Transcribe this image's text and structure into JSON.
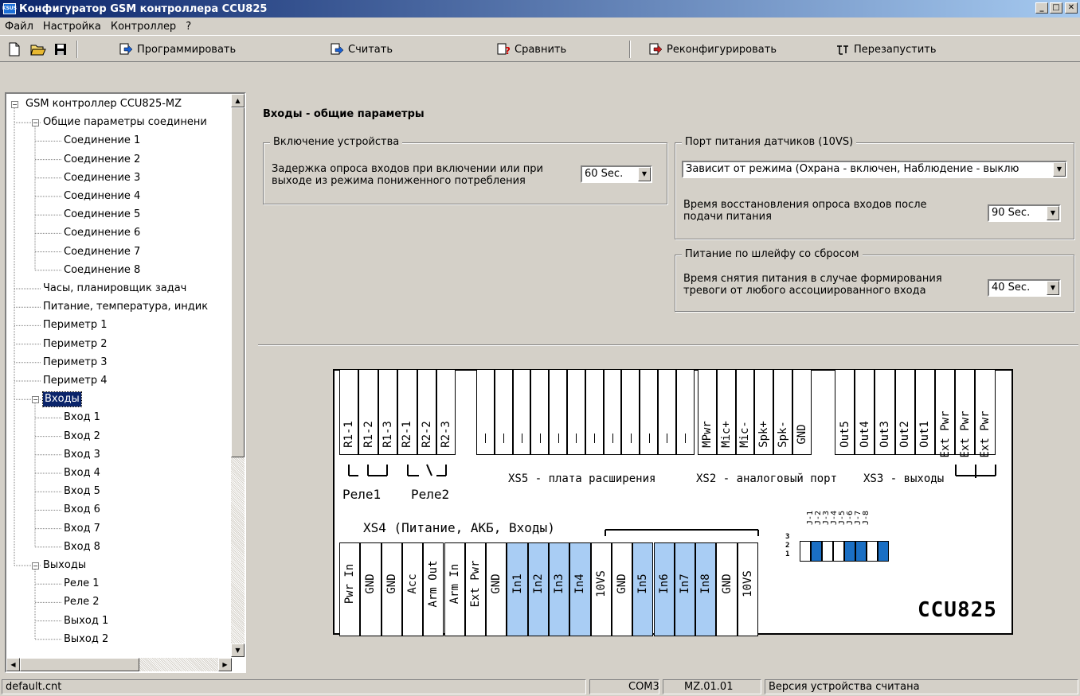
{
  "window": {
    "title": "Конфигуратор GSM контроллера CCU825",
    "app_icon": "ksus-icon",
    "title_color": "#0a246a"
  },
  "menu": {
    "items": [
      "Файл",
      "Настройка",
      "Контроллер",
      "?"
    ]
  },
  "toolbar": {
    "program": "Программировать",
    "read": "Считать",
    "compare": "Сравнить",
    "reconfigure": "Реконфигурировать",
    "restart": "Перезапустить"
  },
  "tree": {
    "items": [
      {
        "label": "GSM контроллер CCU825-MZ",
        "level": 0,
        "expandable": true
      },
      {
        "label": "Общие параметры соединени",
        "level": 1,
        "expandable": true
      },
      {
        "label": "Соединение 1",
        "level": 2
      },
      {
        "label": "Соединение 2",
        "level": 2
      },
      {
        "label": "Соединение 3",
        "level": 2
      },
      {
        "label": "Соединение 4",
        "level": 2
      },
      {
        "label": "Соединение 5",
        "level": 2
      },
      {
        "label": "Соединение 6",
        "level": 2
      },
      {
        "label": "Соединение 7",
        "level": 2
      },
      {
        "label": "Соединение 8",
        "level": 2
      },
      {
        "label": "Часы, планировщик задач",
        "level": 1
      },
      {
        "label": "Питание, температура, индик",
        "level": 1
      },
      {
        "label": "Периметр 1",
        "level": 1
      },
      {
        "label": "Периметр 2",
        "level": 1
      },
      {
        "label": "Периметр 3",
        "level": 1
      },
      {
        "label": "Периметр 4",
        "level": 1
      },
      {
        "label": "Входы",
        "level": 1,
        "expandable": true,
        "selected": true
      },
      {
        "label": "Вход 1",
        "level": 2
      },
      {
        "label": "Вход 2",
        "level": 2
      },
      {
        "label": "Вход 3",
        "level": 2
      },
      {
        "label": "Вход 4",
        "level": 2
      },
      {
        "label": "Вход 5",
        "level": 2
      },
      {
        "label": "Вход 6",
        "level": 2
      },
      {
        "label": "Вход 7",
        "level": 2
      },
      {
        "label": "Вход 8",
        "level": 2
      },
      {
        "label": "Выходы",
        "level": 1,
        "expandable": true
      },
      {
        "label": "Реле 1",
        "level": 2
      },
      {
        "label": "Реле 2",
        "level": 2
      },
      {
        "label": "Выход 1",
        "level": 2
      },
      {
        "label": "Выход 2",
        "level": 2
      }
    ]
  },
  "panel": {
    "title": "Входы - общие параметры",
    "group1": {
      "title": "Включение устройства",
      "label_line1": "Задержка опроса входов при включении или при",
      "label_line2": "выходе из режима пониженного потребления",
      "value": "60 Sec."
    },
    "group2": {
      "title": "Порт питания датчиков (10VS)",
      "mode_value": "Зависит от режима (Охрана - включен, Наблюдение - выклю",
      "label_line1": "Время восстановления опроса входов после",
      "label_line2": "подачи питания",
      "value": "90 Sec."
    },
    "group3": {
      "title": "Питание по шлейфу со сбросом",
      "label_line1": "Время снятия питания в случае формирования",
      "label_line2": "тревоги от любого ассоциированного входа",
      "value": "40 Sec."
    }
  },
  "board": {
    "highlight_color": "#a9cdf4",
    "jumper_color": "#1a6fc4",
    "top_pins_relay": [
      "R1-1",
      "R1-2",
      "R1-3",
      "R2-1",
      "R2-2",
      "R2-3"
    ],
    "top_pins_analog": [
      "MPwr",
      "Mic+",
      "Mic-",
      "Spk+",
      "Spk-",
      "GND"
    ],
    "top_pins_outputs": [
      "Out5",
      "Out4",
      "Out3",
      "Out2",
      "Out1",
      "Ext Pwr",
      "Ext Pwr",
      "Ext Pwr"
    ],
    "relay1_label": "Реле1",
    "relay2_label": "Реле2",
    "xs5_label": "XS5 - плата расширения",
    "xs2_label": "XS2 - аналоговый порт",
    "xs3_label": "XS3 - выходы",
    "xs4_label": "XS4 (Питание, АКБ, Входы)",
    "bottom_pins": [
      "Pwr In",
      "GND",
      "GND",
      "Acc",
      "Arm Out",
      "Arm In",
      "Ext Pwr",
      "GND",
      "In1",
      "In2",
      "In3",
      "In4",
      "10VS",
      "GND",
      "In5",
      "In6",
      "In7",
      "In8",
      "GND",
      "10VS"
    ],
    "bottom_highlight": [
      8,
      9,
      10,
      11,
      14,
      15,
      16,
      17
    ],
    "jumper_labels": [
      "J-1",
      "J-2",
      "J-3",
      "J-4",
      "J-5",
      "J-6",
      "J-7",
      "J-8"
    ],
    "jumper_rows": [
      "3",
      "2",
      "1"
    ],
    "model": "CCU825"
  },
  "status": {
    "file": "default.cnt",
    "port": "COM3",
    "version": "MZ.01.01",
    "message": "Версия устройства считана"
  }
}
